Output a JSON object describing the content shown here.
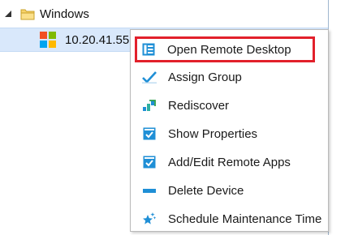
{
  "tree": {
    "group_label": "Windows",
    "device_label": "10.20.41.55"
  },
  "context_menu": {
    "items": [
      {
        "label": "Open Remote Desktop",
        "icon": "remote-desktop-icon",
        "highlighted": true
      },
      {
        "label": "Assign Group",
        "icon": "checkmark-icon"
      },
      {
        "label": "Rediscover",
        "icon": "rediscover-icon"
      },
      {
        "label": "Show Properties",
        "icon": "properties-icon"
      },
      {
        "label": "Add/Edit Remote Apps",
        "icon": "remote-apps-icon"
      },
      {
        "label": "Delete Device",
        "icon": "minus-icon"
      },
      {
        "label": "Schedule Maintenance Time",
        "icon": "maintenance-star-icon"
      }
    ]
  },
  "colors": {
    "selection_bg": "#d9e8fb",
    "highlight_outline": "#e2202b",
    "icon_blue": "#1f8fd6"
  }
}
